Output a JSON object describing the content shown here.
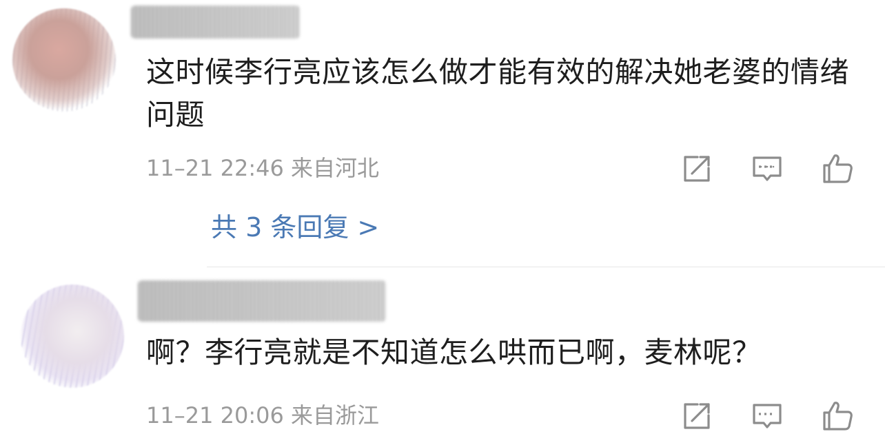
{
  "comments": [
    {
      "text": "这时候李行亮应该怎么做才能有效的解决她老婆的情绪问题",
      "time": "11–21 22:46",
      "location": "来自河北",
      "replies_label": "共 3 条回复 >"
    },
    {
      "text": "啊？李行亮就是不知道怎么哄而已啊，麦林呢？",
      "time": "11–21 20:06",
      "location": "来自浙江"
    }
  ],
  "icons": {
    "share": "share-icon",
    "comment": "comment-icon",
    "like": "like-icon"
  },
  "colors": {
    "text": "#1e1e1e",
    "meta": "#9a9a9a",
    "link": "#4a79b4",
    "icon": "#8c8c8c",
    "divider": "#e6e6e6"
  }
}
